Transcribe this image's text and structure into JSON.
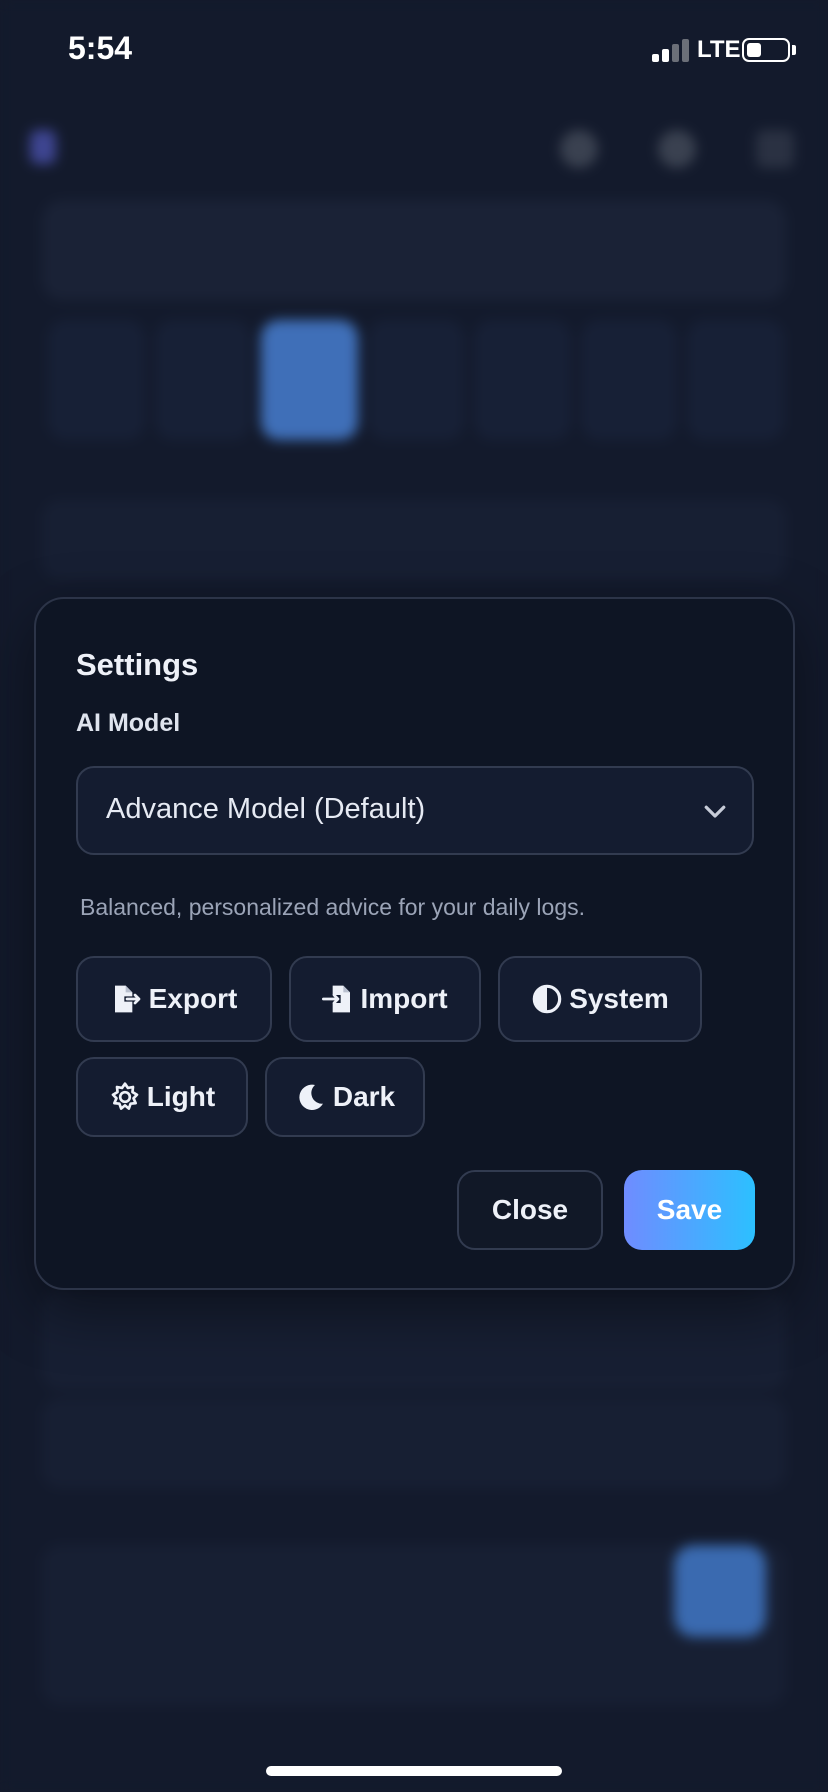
{
  "status_bar": {
    "time": "5:54",
    "network": "LTE",
    "battery_level": 0.35
  },
  "settings_modal": {
    "title": "Settings",
    "ai_model_label": "AI Model",
    "ai_model_selected": "Advance Model (Default)",
    "ai_model_description": "Balanced, personalized advice for your daily logs.",
    "actions": {
      "export_label": "Export",
      "import_label": "Import",
      "system_label": "System",
      "light_label": "Light",
      "dark_label": "Dark"
    },
    "close_label": "Close",
    "save_label": "Save"
  },
  "colors": {
    "background": "#141a2b",
    "modal_background": "#0e1524",
    "button_background": "#141c30",
    "accent_gradient_start": "#6f8cff",
    "accent_gradient_end": "#2cc0ff"
  },
  "icons": {
    "export": "file-export-icon",
    "import": "file-import-icon",
    "system": "half-circle-contrast-icon",
    "light": "sun-gear-icon",
    "dark": "moon-icon",
    "dropdown": "chevron-down-icon"
  }
}
